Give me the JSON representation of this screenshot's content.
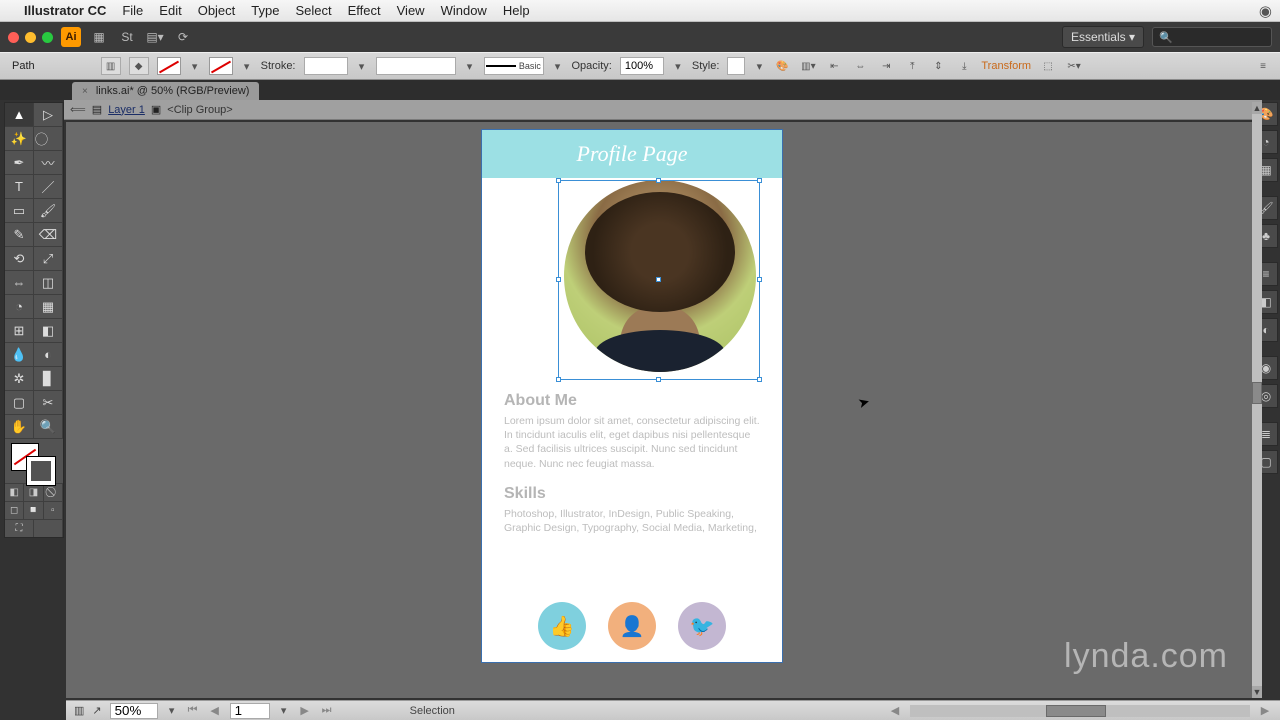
{
  "menu": {
    "app": "Illustrator CC",
    "items": [
      "File",
      "Edit",
      "Object",
      "Type",
      "Select",
      "Effect",
      "View",
      "Window",
      "Help"
    ]
  },
  "workspace": "Essentials",
  "control": {
    "selection_label": "Path",
    "stroke_label": "Stroke:",
    "stroke_weight": "",
    "brush_label": "Basic",
    "opacity_label": "Opacity:",
    "opacity_value": "100%",
    "style_label": "Style:",
    "transform_label": "Transform"
  },
  "document": {
    "tab": "links.ai* @ 50% (RGB/Preview)",
    "breadcrumb_layer": "Layer 1",
    "breadcrumb_group": "<Clip Group>"
  },
  "artboard": {
    "header": "Profile Page",
    "about_h": "About Me",
    "about_p": "Lorem ipsum dolor sit amet, consectetur adipiscing elit. In tincidunt iaculis elit, eget dapibus nisi pellentesque a. Sed facilisis ultrices suscipit. Nunc sed tincidunt neque. Nunc nec feugiat massa.",
    "skills_h": "Skills",
    "skills_p": "Photoshop, Illustrator, InDesign, Public Speaking, Graphic Design, Typography, Social Media, Marketing,"
  },
  "status": {
    "zoom": "50%",
    "artboard_num": "1",
    "tool": "Selection"
  },
  "watermark": "lynda.com"
}
